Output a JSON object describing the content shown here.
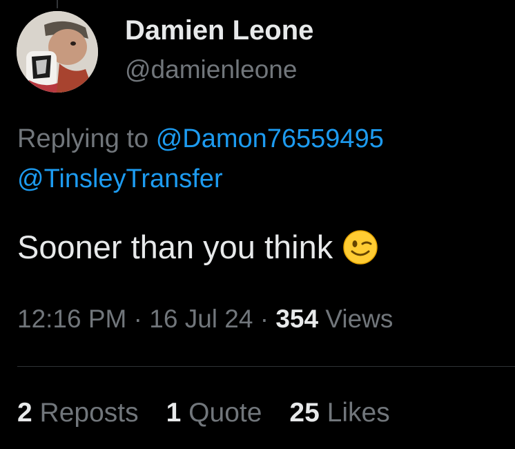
{
  "author": {
    "display_name": "Damien Leone",
    "handle": "@damienleone"
  },
  "reply": {
    "prefix": "Replying to",
    "mention_1": "@Damon76559495",
    "mention_2": "@TinsleyTransfer"
  },
  "tweet": {
    "text": "Sooner than you think",
    "emoji": "winking-face"
  },
  "meta": {
    "time": "12:16 PM",
    "separator": "·",
    "date": "16 Jul 24",
    "views_count": "354",
    "views_label": "Views"
  },
  "stats": {
    "reposts_count": "2",
    "reposts_label": "Reposts",
    "quotes_count": "1",
    "quotes_label": "Quote",
    "likes_count": "25",
    "likes_label": "Likes"
  },
  "colors": {
    "background": "#000000",
    "primary_text": "#e7e9ea",
    "secondary_text": "#71767b",
    "link": "#1d9bf0",
    "divider": "#2f3336"
  }
}
